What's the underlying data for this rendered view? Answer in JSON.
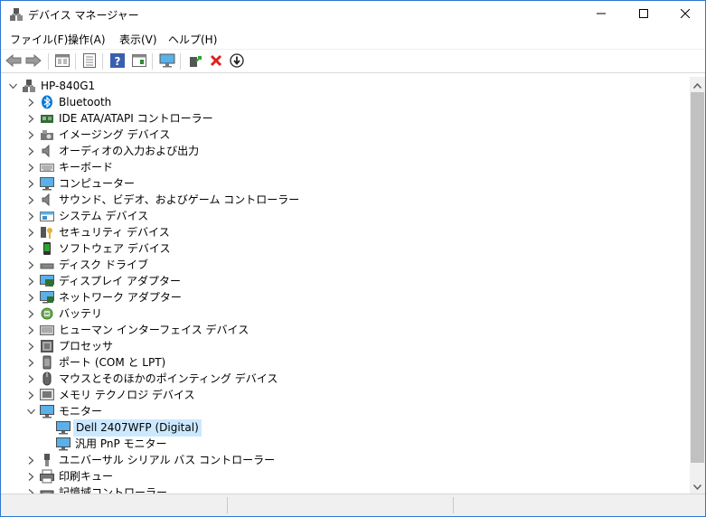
{
  "window": {
    "title": "デバイス マネージャー",
    "buttons": {
      "minimize_icon": "minimize-icon",
      "maximize_icon": "maximize-icon",
      "close_icon": "close-icon"
    }
  },
  "menu": [
    "ファイル(F)",
    "操作(A)",
    "表示(V)",
    "ヘルプ(H)"
  ],
  "toolbar": [
    "back-icon",
    "forward-icon",
    "properties-view-icon",
    "list-view-icon",
    "help-icon",
    "details-icon",
    "monitor-scan-icon",
    "update-driver-icon",
    "uninstall-icon",
    "download-icon"
  ],
  "tree": {
    "root": "HP-840G1",
    "categories": [
      {
        "label": "Bluetooth",
        "icon": "bluetooth-icon",
        "expanded": false
      },
      {
        "label": "IDE ATA/ATAPI コントローラー",
        "icon": "ide-controller-icon",
        "expanded": false
      },
      {
        "label": "イメージング デバイス",
        "icon": "camera-icon",
        "expanded": false
      },
      {
        "label": "オーディオの入力および出力",
        "icon": "speaker-icon",
        "expanded": false
      },
      {
        "label": "キーボード",
        "icon": "keyboard-icon",
        "expanded": false
      },
      {
        "label": "コンピューター",
        "icon": "computer-icon",
        "expanded": false
      },
      {
        "label": "サウンド、ビデオ、およびゲーム コントローラー",
        "icon": "speaker-icon",
        "expanded": false
      },
      {
        "label": "システム デバイス",
        "icon": "system-device-icon",
        "expanded": false
      },
      {
        "label": "セキュリティ デバイス",
        "icon": "security-key-icon",
        "expanded": false
      },
      {
        "label": "ソフトウェア デバイス",
        "icon": "software-device-icon",
        "expanded": false
      },
      {
        "label": "ディスク ドライブ",
        "icon": "disk-drive-icon",
        "expanded": false
      },
      {
        "label": "ディスプレイ アダプター",
        "icon": "display-adapter-icon",
        "expanded": false
      },
      {
        "label": "ネットワーク アダプター",
        "icon": "network-adapter-icon",
        "expanded": false
      },
      {
        "label": "バッテリ",
        "icon": "battery-icon",
        "expanded": false
      },
      {
        "label": "ヒューマン インターフェイス デバイス",
        "icon": "hid-icon",
        "expanded": false
      },
      {
        "label": "プロセッサ",
        "icon": "processor-icon",
        "expanded": false
      },
      {
        "label": "ポート (COM と LPT)",
        "icon": "port-icon",
        "expanded": false
      },
      {
        "label": "マウスとそのほかのポインティング デバイス",
        "icon": "mouse-icon",
        "expanded": false
      },
      {
        "label": "メモリ テクノロジ デバイス",
        "icon": "memory-icon",
        "expanded": false
      },
      {
        "label": "モニター",
        "icon": "monitor-icon",
        "expanded": true,
        "children": [
          {
            "label": "Dell 2407WFP (Digital)",
            "icon": "monitor-icon",
            "selected": true
          },
          {
            "label": "汎用 PnP モニター",
            "icon": "monitor-icon",
            "selected": false
          }
        ]
      },
      {
        "label": "ユニバーサル シリアル バス コントローラー",
        "icon": "usb-icon",
        "expanded": false
      },
      {
        "label": "印刷キュー",
        "icon": "printer-icon",
        "expanded": false
      },
      {
        "label": "記憶域コントローラー",
        "icon": "storage-controller-icon",
        "expanded": false
      }
    ]
  },
  "colors": {
    "selection": "#cce8ff",
    "accent": "#2b78d4"
  }
}
